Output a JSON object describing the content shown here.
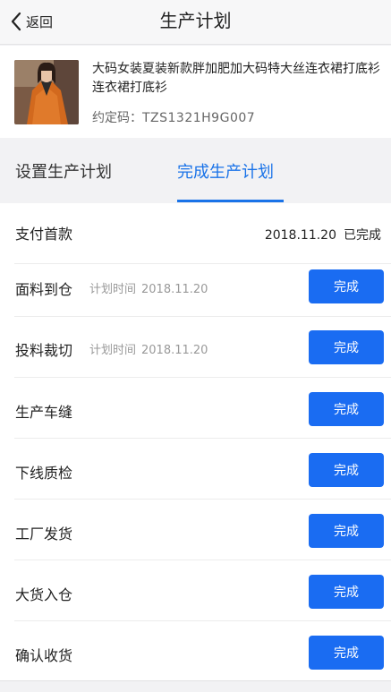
{
  "nav": {
    "back_label": "返回",
    "title": "生产计划"
  },
  "product": {
    "title": "大码女装夏装新款胖加肥加大码特大丝连衣裙打底衫连衣裙打底衫",
    "code_label": "约定码：",
    "code_value": "TZS1321H9G007"
  },
  "tabs": {
    "setup": "设置生产计划",
    "done": "完成生产计划",
    "active": "done"
  },
  "steps": [
    {
      "label": "支付首款",
      "status_date": "2018.11.20",
      "status_text": "已完成"
    },
    {
      "label": "面料到仓",
      "plan_label": "计划时间",
      "plan_date": "2018.11.20",
      "button": "完成"
    },
    {
      "label": "投料裁切",
      "plan_label": "计划时间",
      "plan_date": "2018.11.20",
      "button": "完成"
    },
    {
      "label": "生产车缝",
      "button": "完成"
    },
    {
      "label": "下线质检",
      "button": "完成"
    },
    {
      "label": "工厂发货",
      "button": "完成"
    },
    {
      "label": "大货入仓",
      "button": "完成"
    },
    {
      "label": "确认收货",
      "button": "完成"
    }
  ],
  "colors": {
    "accent": "#1a73e8",
    "button": "#1a6cf2",
    "background": "#f2f2f4"
  }
}
